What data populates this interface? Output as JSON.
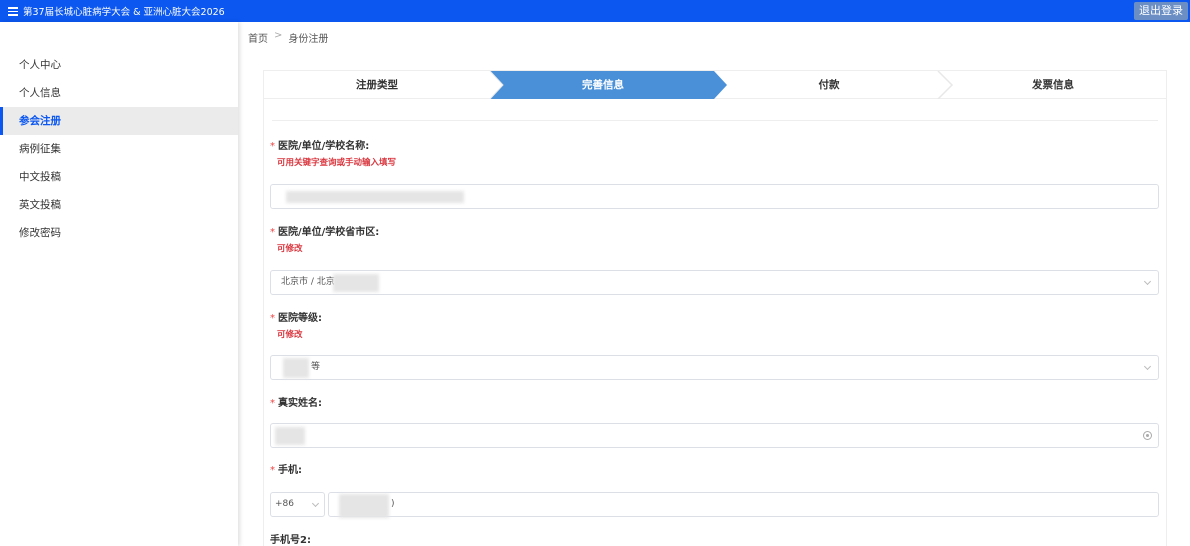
{
  "header": {
    "title": "第37届长城心脏病学大会 & 亚洲心脏大会2026",
    "logout_label": "退出登录",
    "bg_color": "#0b57f0"
  },
  "sidebar": {
    "items": [
      {
        "label": "个人中心",
        "active": false
      },
      {
        "label": "个人信息",
        "active": false
      },
      {
        "label": "参会注册",
        "active": true
      },
      {
        "label": "病例征集",
        "active": false
      },
      {
        "label": "中文投稿",
        "active": false
      },
      {
        "label": "英文投稿",
        "active": false
      },
      {
        "label": "修改密码",
        "active": false
      }
    ]
  },
  "breadcrumb": {
    "home": "首页",
    "separator": ">",
    "current": "身份注册"
  },
  "steps": [
    {
      "label": "注册类型",
      "active": false
    },
    {
      "label": "完善信息",
      "active": true
    },
    {
      "label": "付款",
      "active": false
    },
    {
      "label": "发票信息",
      "active": false
    }
  ],
  "form": {
    "institution": {
      "label": "医院/单位/学校名称:",
      "hint": "可用关键字查询或手动输入填写",
      "value": ""
    },
    "region": {
      "label": "医院/单位/学校省市区:",
      "hint": "可修改",
      "value": "北京市 / 北京"
    },
    "grade": {
      "label": "医院等级:",
      "hint": "可修改",
      "value": "等"
    },
    "real_name": {
      "label": "真实姓名:",
      "value": ""
    },
    "phone": {
      "label": "手机:",
      "country_code": "+86",
      "value": ")"
    },
    "phone2": {
      "label": "手机号2:"
    }
  },
  "colors": {
    "accent": "#0b57f0",
    "active_step": "#4a90d9",
    "required": "#e44444",
    "hint": "#d9363e"
  }
}
